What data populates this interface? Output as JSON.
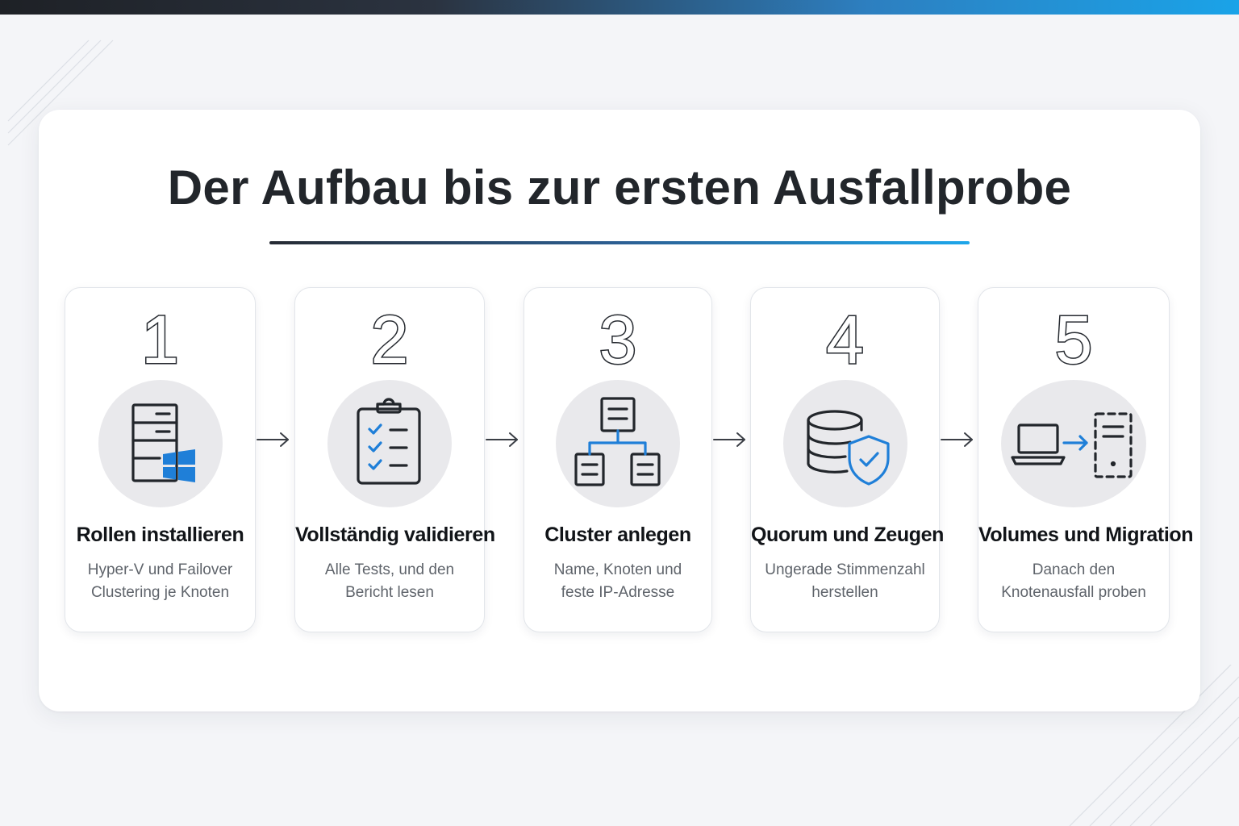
{
  "title": "Der Aufbau bis zur ersten Ausfallprobe",
  "colors": {
    "accent_blue": "#1f7fd8",
    "dark_text": "#22262b",
    "muted_text": "#5f646b",
    "icon_circle": "#e9e9ec",
    "background": "#f4f5f8"
  },
  "steps": [
    {
      "number": "1",
      "icon": "server-windows-icon",
      "title": "Rollen installieren",
      "description": "Hyper-V und Failover Clustering je Knoten"
    },
    {
      "number": "2",
      "icon": "clipboard-checklist-icon",
      "title": "Vollständig validieren",
      "description": "Alle Tests, und den Bericht lesen"
    },
    {
      "number": "3",
      "icon": "cluster-hierarchy-icon",
      "title": "Cluster anlegen",
      "description": "Name, Knoten und feste IP-Adresse"
    },
    {
      "number": "4",
      "icon": "database-shield-icon",
      "title": "Quorum und Zeugen",
      "description": "Ungerade Stimmenzahl herstellen"
    },
    {
      "number": "5",
      "icon": "laptop-migration-icon",
      "title": "Volumes und Migration",
      "description": "Danach den Knotenausfall proben"
    }
  ]
}
